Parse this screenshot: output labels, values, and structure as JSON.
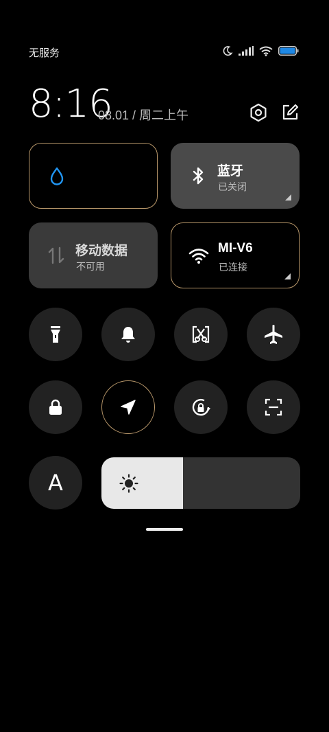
{
  "status_bar": {
    "carrier": "无服务",
    "icons": [
      "moon-icon",
      "signal-icon",
      "wifi-icon",
      "battery-icon"
    ],
    "battery_color": "#1e88e5"
  },
  "header": {
    "time": "8:16",
    "date": "08.01 / 周二上午",
    "icons": [
      "settings-icon",
      "edit-icon"
    ]
  },
  "tiles": [
    {
      "id": "data-saver",
      "title": "",
      "subtitle": "",
      "state": "on",
      "icon": "water-drop-icon"
    },
    {
      "id": "bluetooth",
      "title": "蓝牙",
      "subtitle": "已关闭",
      "state": "off",
      "icon": "bluetooth-icon"
    },
    {
      "id": "mobile-data",
      "title": "移动数据",
      "subtitle": "不可用",
      "state": "unavailable",
      "icon": "mobile-data-icon"
    },
    {
      "id": "wifi",
      "title": "MI-V6",
      "subtitle": "已连接",
      "state": "on",
      "icon": "wifi-icon"
    }
  ],
  "toggles": [
    {
      "id": "flashlight",
      "icon": "flashlight-icon",
      "state": "off"
    },
    {
      "id": "ring",
      "icon": "bell-icon",
      "state": "off"
    },
    {
      "id": "screenshot",
      "icon": "scissors-icon",
      "state": "off"
    },
    {
      "id": "airplane",
      "icon": "airplane-icon",
      "state": "off"
    },
    {
      "id": "lock",
      "icon": "lock-icon",
      "state": "off"
    },
    {
      "id": "location",
      "icon": "location-arrow-icon",
      "state": "on"
    },
    {
      "id": "rotation-lock",
      "icon": "rotation-lock-icon",
      "state": "off"
    },
    {
      "id": "scanner",
      "icon": "scan-icon",
      "state": "off"
    }
  ],
  "font_button": {
    "label": "A"
  },
  "brightness": {
    "level": 0.41,
    "icon": "sun-icon"
  },
  "accent_color": "#b8976a",
  "wifi_corner_color": "#cccccc"
}
